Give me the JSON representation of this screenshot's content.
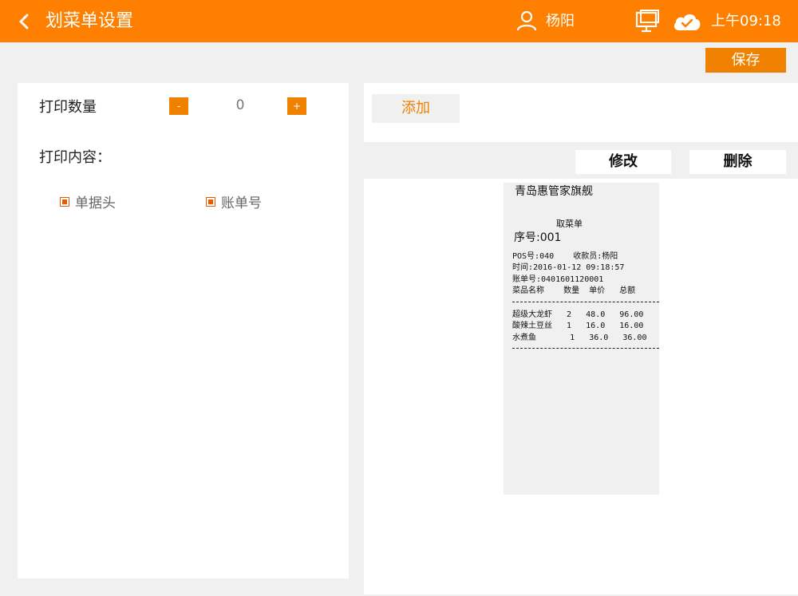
{
  "header": {
    "title": "划菜单设置",
    "user_name": "杨阳",
    "clock": "上午09:18",
    "icons": [
      "back-icon",
      "user-icon",
      "monitor-icon",
      "cloud-check-icon"
    ],
    "background": "#ff8000"
  },
  "toolbar": {
    "save_label": "保存"
  },
  "settings": {
    "quantity_label": "打印数量",
    "quantity_minus": "-",
    "quantity_value": "0",
    "quantity_plus": "+",
    "content_label": "打印内容：",
    "options": [
      {
        "label": "单据头",
        "checked": true
      },
      {
        "label": "账单号",
        "checked": true
      }
    ]
  },
  "actions": {
    "add_label": "添加",
    "edit_label": "修改",
    "delete_label": "删除"
  },
  "receipt": {
    "store": "青岛惠管家旗舰",
    "type": "取菜单",
    "sequence": "序号:001",
    "pos_line": "POS号:040    收款员:杨阳",
    "time_line": "时间:2016-01-12 09:18:57",
    "bill_line": "账单号:0401601120001",
    "columns_line": "菜品名称    数量  单价   总额",
    "items": [
      "超级大龙虾   2   48.0   96.00",
      "酸辣土豆丝   1   16.0   16.00",
      "水煮鱼       1   36.0   36.00"
    ]
  },
  "colors": {
    "accent": "#ff8000",
    "button": "#f08000",
    "checkbox": "#e65a00"
  }
}
